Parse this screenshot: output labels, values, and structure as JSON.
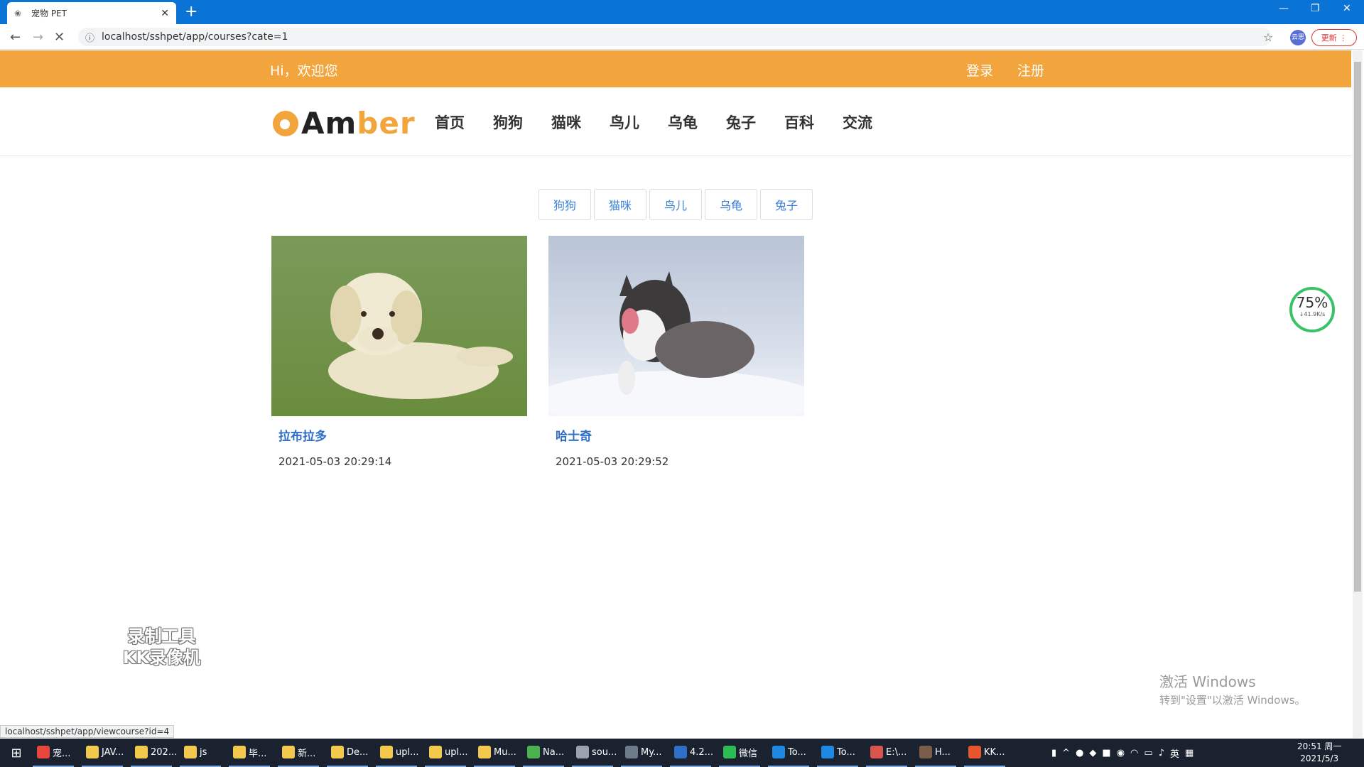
{
  "browser": {
    "tab_title": "宠物 PET",
    "url": "localhost/sshpet/app/courses?cate=1",
    "update_label": "更新",
    "profile_label": "云思"
  },
  "site": {
    "welcome": "Hi，欢迎您",
    "login": "登录",
    "register": "注册",
    "logo_part1": "Am",
    "logo_part2": "ber",
    "nav": [
      "首页",
      "狗狗",
      "猫咪",
      "鸟儿",
      "乌龟",
      "兔子",
      "百科",
      "交流"
    ],
    "filters": [
      "狗狗",
      "猫咪",
      "鸟儿",
      "乌龟",
      "兔子"
    ]
  },
  "courses": [
    {
      "name": "拉布拉多",
      "date": "2021-05-03 20:29:14"
    },
    {
      "name": "哈士奇",
      "date": "2021-05-03 20:29:52"
    }
  ],
  "overlays": {
    "speed_percent": "75%",
    "speed_rate": "↓41.9K/s",
    "watermark_line1": "录制工具",
    "watermark_line2": "KK录像机",
    "activate_line1": "激活 Windows",
    "activate_line2": "转到\"设置\"以激活 Windows。",
    "status_url": "localhost/sshpet/app/viewcourse?id=4"
  },
  "taskbar": {
    "items": [
      "宠...",
      "JAV...",
      "202...",
      "js",
      "毕...",
      "新...",
      "De...",
      "upl...",
      "upl...",
      "Mu...",
      "Na...",
      "sou...",
      "My...",
      "4.2...",
      "微信",
      "To...",
      "To...",
      "E:\\...",
      "H...",
      "KK..."
    ],
    "ime": "英",
    "time": "20:51 周一",
    "date": "2021/5/3"
  }
}
